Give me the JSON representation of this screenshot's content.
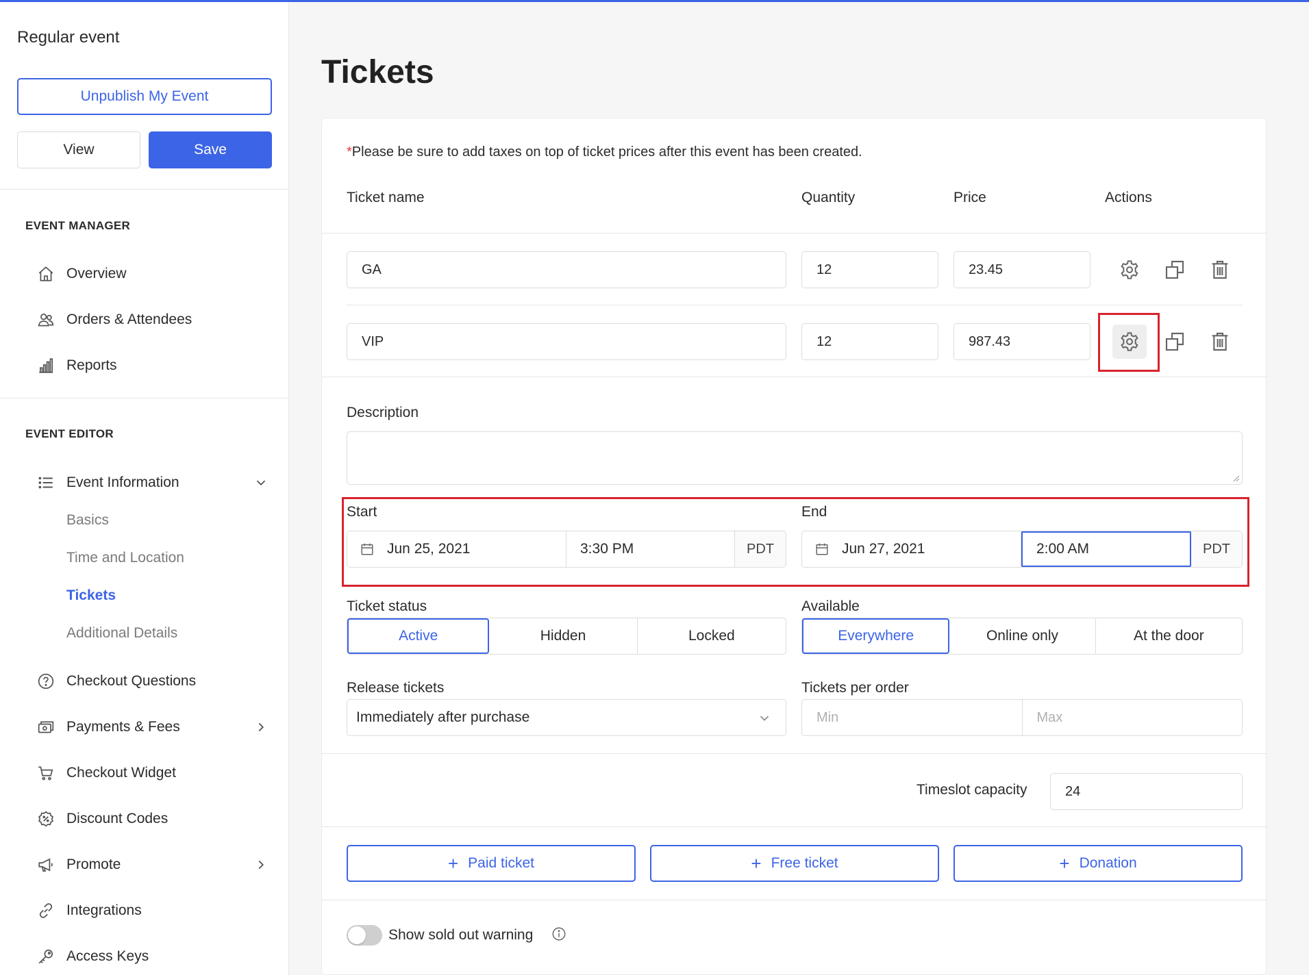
{
  "sidebar": {
    "event_name": "Regular event",
    "unpublish_label": "Unpublish My Event",
    "view_label": "View",
    "save_label": "Save",
    "manager_heading": "EVENT MANAGER",
    "manager_items": [
      {
        "label": "Overview",
        "icon": "home-icon"
      },
      {
        "label": "Orders & Attendees",
        "icon": "users-icon"
      },
      {
        "label": "Reports",
        "icon": "bar-chart-icon"
      }
    ],
    "editor_heading": "EVENT EDITOR",
    "event_info_label": "Event Information",
    "event_info_subitems": [
      "Basics",
      "Time and Location",
      "Tickets",
      "Additional Details"
    ],
    "active_subitem": "Tickets",
    "editor_items": [
      {
        "label": "Checkout Questions",
        "icon": "question-circle-icon"
      },
      {
        "label": "Payments & Fees",
        "icon": "payments-icon",
        "has_submenu": true
      },
      {
        "label": "Checkout Widget",
        "icon": "cart-icon"
      },
      {
        "label": "Discount Codes",
        "icon": "discount-icon"
      },
      {
        "label": "Promote",
        "icon": "megaphone-icon",
        "has_submenu": true
      },
      {
        "label": "Integrations",
        "icon": "link-icon"
      },
      {
        "label": "Access Keys",
        "icon": "key-icon"
      }
    ]
  },
  "main": {
    "title": "Tickets",
    "notice_star": "*",
    "notice": "Please be sure to add taxes on top of ticket prices after this event has been created.",
    "columns": {
      "name": "Ticket name",
      "quantity": "Quantity",
      "price": "Price",
      "actions": "Actions"
    },
    "tickets": [
      {
        "name": "GA",
        "quantity": "12",
        "price": "23.45"
      },
      {
        "name": "VIP",
        "quantity": "12",
        "price": "987.43"
      }
    ],
    "settings": {
      "description_label": "Description",
      "description_value": "",
      "start_label": "Start",
      "start_date": "Jun 25, 2021",
      "start_time": "3:30 PM",
      "start_tz": "PDT",
      "end_label": "End",
      "end_date": "Jun 27, 2021",
      "end_time": "2:00 AM",
      "end_tz": "PDT",
      "status_label": "Ticket status",
      "status_options": [
        "Active",
        "Hidden",
        "Locked"
      ],
      "status_selected": "Active",
      "available_label": "Available",
      "available_options": [
        "Everywhere",
        "Online only",
        "At the door"
      ],
      "available_selected": "Everywhere",
      "release_label": "Release tickets",
      "release_value": "Immediately after purchase",
      "per_order_label": "Tickets per order",
      "min_placeholder": "Min",
      "max_placeholder": "Max"
    },
    "timeslot_label": "Timeslot capacity",
    "timeslot_value": "24",
    "add_buttons": [
      "Paid ticket",
      "Free ticket",
      "Donation"
    ],
    "add_plus": "+",
    "sold_out_label": "Show sold out warning",
    "sold_out_enabled": false
  },
  "colors": {
    "accent": "#3c64e6",
    "highlight": "#d9232d",
    "required_star": "#e53935"
  }
}
